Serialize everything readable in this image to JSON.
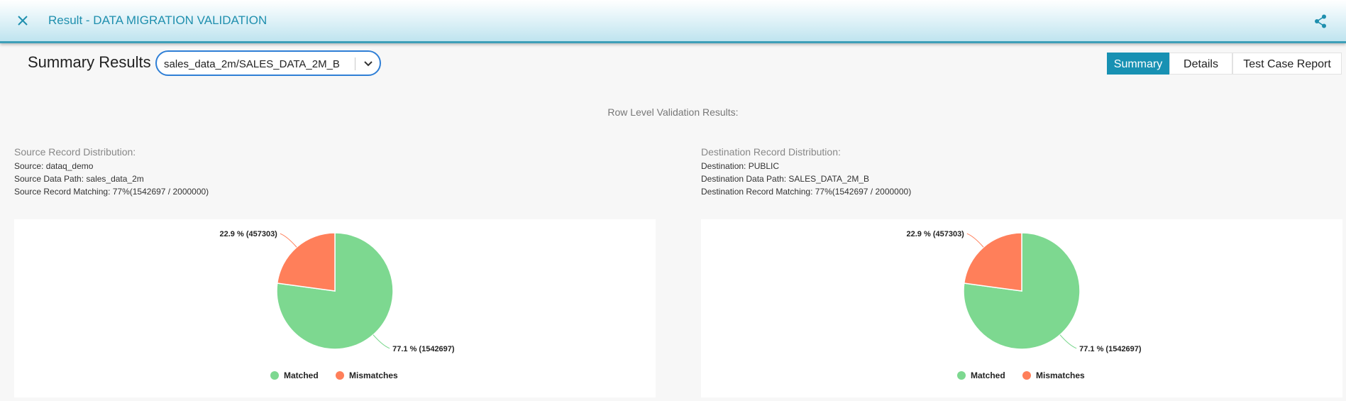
{
  "header": {
    "title": "Result - DATA MIGRATION VALIDATION",
    "close_icon": "close-icon",
    "share_icon": "share-icon"
  },
  "summary": {
    "title": "Summary Results",
    "dataset_select": {
      "value": "sales_data_2m/SALES_DATA_2M_B"
    }
  },
  "tabs": [
    {
      "label": "Summary",
      "active": true
    },
    {
      "label": "Details",
      "active": false
    },
    {
      "label": "Test Case Report",
      "active": false
    }
  ],
  "row_level_title": "Row Level Validation Results:",
  "source": {
    "heading": "Source Record Distribution:",
    "lines": [
      "Source: dataq_demo",
      "Source Data Path: sales_data_2m",
      "Source Record Matching: 77%(1542697 / 2000000)"
    ]
  },
  "destination": {
    "heading": "Destination Record Distribution:",
    "lines": [
      "Destination: PUBLIC",
      "Destination Data Path: SALES_DATA_2M_B",
      "Destination Record Matching: 77%(1542697 / 2000000)"
    ]
  },
  "colors": {
    "matched": "#7dd890",
    "mismatches": "#ff7f5a",
    "accent": "#1891b3"
  },
  "chart_data": [
    {
      "type": "pie",
      "slices": [
        {
          "name": "Matched",
          "value": 1542697,
          "label": "77.1 % (1542697)"
        },
        {
          "name": "Mismatches",
          "value": 457303,
          "label": "22.9 % (457303)"
        }
      ],
      "legend": [
        "Matched",
        "Mismatches"
      ],
      "legend_position": "bottom"
    },
    {
      "type": "pie",
      "slices": [
        {
          "name": "Matched",
          "value": 1542697,
          "label": "77.1 % (1542697)"
        },
        {
          "name": "Mismatches",
          "value": 457303,
          "label": "22.9 % (457303)"
        }
      ],
      "legend": [
        "Matched",
        "Mismatches"
      ],
      "legend_position": "bottom"
    }
  ]
}
